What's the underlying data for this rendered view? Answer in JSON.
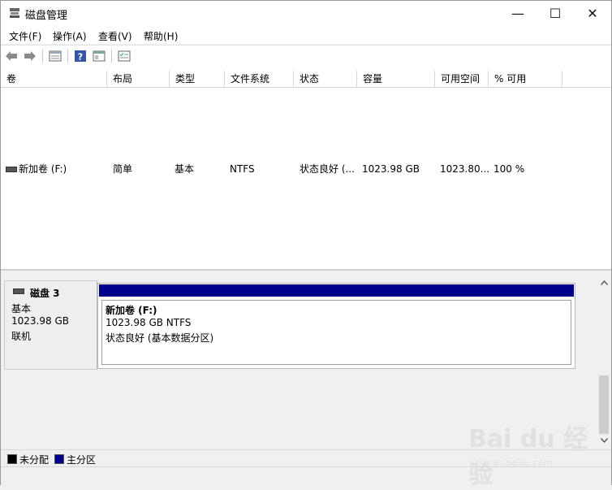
{
  "window": {
    "title": "磁盘管理"
  },
  "window_controls": {
    "minimize": "—",
    "maximize": "☐",
    "close": "✕"
  },
  "menu": [
    "文件(F)",
    "操作(A)",
    "查看(V)",
    "帮助(H)"
  ],
  "toolbar": {
    "back_icon": "arrow-left-icon",
    "forward_icon": "arrow-right-icon",
    "properties_icon": "properties-icon",
    "help_icon": "help-icon",
    "console_icon": "console-icon",
    "checklist_icon": "checklist-icon"
  },
  "volume_table": {
    "columns": [
      "卷",
      "布局",
      "类型",
      "文件系统",
      "状态",
      "容量",
      "可用空间",
      "% 可用"
    ],
    "rows": [
      {
        "volume": "新加卷 (F:)",
        "layout": "简单",
        "type": "基本",
        "filesystem": "NTFS",
        "status": "状态良好 (...",
        "capacity": "1023.98 GB",
        "free": "1023.80...",
        "percent_free": "100 %"
      }
    ]
  },
  "disk": {
    "name": "磁盘 3",
    "type": "基本",
    "size": "1023.98 GB",
    "state": "联机",
    "partition": {
      "name": "新加卷  (F:)",
      "size_fs": "1023.98 GB NTFS",
      "status": "状态良好 (基本数据分区)"
    }
  },
  "legend": [
    {
      "label": "未分配",
      "color": "#000000"
    },
    {
      "label": "主分区",
      "color": "#00008b"
    }
  ],
  "watermark": {
    "brand": "Bai du 经验",
    "url": "jingyan.baidu.com"
  }
}
